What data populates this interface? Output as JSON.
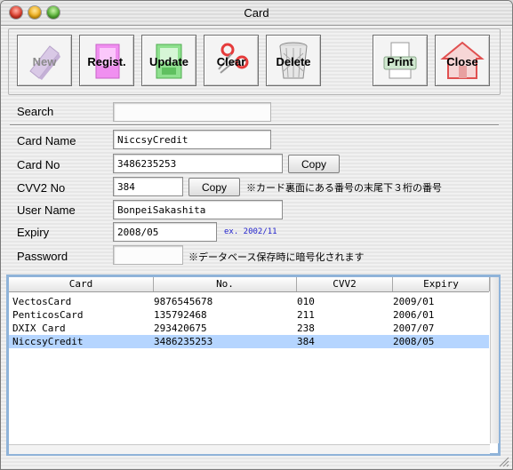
{
  "window": {
    "title": "Card"
  },
  "toolbar": {
    "new": "New",
    "regist": "Regist.",
    "update": "Update",
    "clear": "Clear",
    "delete": "Delete",
    "print": "Print",
    "close": "Close"
  },
  "form": {
    "search_label": "Search",
    "search_value": "",
    "card_name_label": "Card Name",
    "card_name_value": "NiccsyCredit",
    "card_no_label": "Card No",
    "card_no_value": "3486235253",
    "card_no_copy": "Copy",
    "cvv2_label": "CVV2 No",
    "cvv2_value": "384",
    "cvv2_copy": "Copy",
    "cvv2_note": "※カード裏面にある番号の末尾下３桁の番号",
    "user_name_label": "User Name",
    "user_name_value": "BonpeiSakashita",
    "expiry_label": "Expiry",
    "expiry_value": "2008/05",
    "expiry_hint": "ex. 2002/11",
    "password_label": "Password",
    "password_value": "",
    "password_note": "※データベース保存時に暗号化されます"
  },
  "table": {
    "columns": [
      "Card",
      "No.",
      "CVV2",
      "Expiry"
    ],
    "rows": [
      [
        "VectosCard",
        "9876545678",
        "010",
        "2009/01"
      ],
      [
        "PenticosCard",
        "135792468",
        "211",
        "2006/01"
      ],
      [
        "DXIX Card",
        "293420675",
        "238",
        "2007/07"
      ],
      [
        "NiccsyCredit",
        "3486235253",
        "384",
        "2008/05"
      ]
    ],
    "selected_row": 3
  },
  "colors": {
    "selection": "#b5d5ff",
    "table_border": "#8fb3d9",
    "hint_text": "#2222cc"
  }
}
